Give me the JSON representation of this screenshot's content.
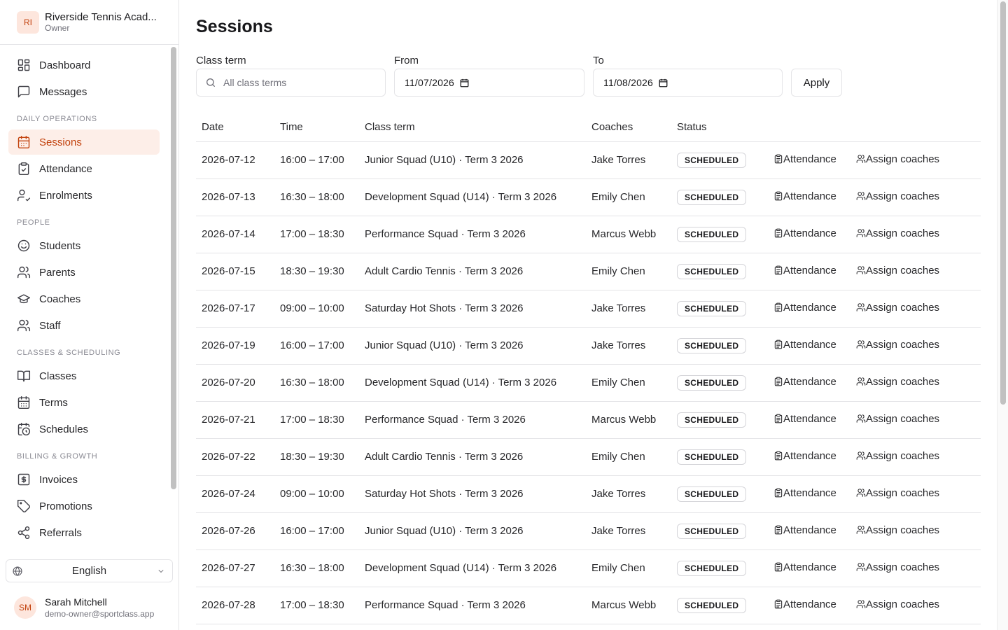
{
  "org": {
    "initials": "RI",
    "name": "Riverside Tennis Acad...",
    "role": "Owner"
  },
  "nav": {
    "top": [
      {
        "label": "Dashboard",
        "icon": "dashboard-icon"
      },
      {
        "label": "Messages",
        "icon": "message-icon"
      }
    ],
    "sections": [
      {
        "title": "DAILY OPERATIONS",
        "items": [
          {
            "label": "Sessions",
            "icon": "calendar-icon",
            "active": true
          },
          {
            "label": "Attendance",
            "icon": "clipboard-check-icon"
          },
          {
            "label": "Enrolments",
            "icon": "user-check-icon"
          }
        ]
      },
      {
        "title": "PEOPLE",
        "items": [
          {
            "label": "Students",
            "icon": "smile-icon"
          },
          {
            "label": "Parents",
            "icon": "users-icon"
          },
          {
            "label": "Coaches",
            "icon": "graduation-cap-icon"
          },
          {
            "label": "Staff",
            "icon": "users-icon"
          }
        ]
      },
      {
        "title": "CLASSES & SCHEDULING",
        "items": [
          {
            "label": "Classes",
            "icon": "book-icon"
          },
          {
            "label": "Terms",
            "icon": "calendar-days-icon"
          },
          {
            "label": "Schedules",
            "icon": "calendar-clock-icon"
          }
        ]
      },
      {
        "title": "BILLING & GROWTH",
        "items": [
          {
            "label": "Invoices",
            "icon": "receipt-icon"
          },
          {
            "label": "Promotions",
            "icon": "tag-icon"
          },
          {
            "label": "Referrals",
            "icon": "share-icon"
          }
        ]
      }
    ]
  },
  "language": {
    "selected": "English"
  },
  "user": {
    "initials": "SM",
    "name": "Sarah Mitchell",
    "email": "demo-owner@sportclass.app"
  },
  "page": {
    "title": "Sessions"
  },
  "filters": {
    "class_term_label": "Class term",
    "class_term_placeholder": "All class terms",
    "from_label": "From",
    "from_value": "11/07/2026",
    "to_label": "To",
    "to_value": "11/08/2026",
    "apply_label": "Apply"
  },
  "table": {
    "headers": [
      "Date",
      "Time",
      "Class term",
      "Coaches",
      "Status"
    ],
    "attendance_label": "Attendance",
    "assign_label": "Assign coaches",
    "rows": [
      {
        "date": "2026-07-12",
        "time": "16:00 – 17:00",
        "class_term": "Junior Squad (U10) · Term 3 2026",
        "coach": "Jake Torres",
        "status": "SCHEDULED"
      },
      {
        "date": "2026-07-13",
        "time": "16:30 – 18:00",
        "class_term": "Development Squad (U14) · Term 3 2026",
        "coach": "Emily Chen",
        "status": "SCHEDULED"
      },
      {
        "date": "2026-07-14",
        "time": "17:00 – 18:30",
        "class_term": "Performance Squad · Term 3 2026",
        "coach": "Marcus Webb",
        "status": "SCHEDULED"
      },
      {
        "date": "2026-07-15",
        "time": "18:30 – 19:30",
        "class_term": "Adult Cardio Tennis · Term 3 2026",
        "coach": "Emily Chen",
        "status": "SCHEDULED"
      },
      {
        "date": "2026-07-17",
        "time": "09:00 – 10:00",
        "class_term": "Saturday Hot Shots · Term 3 2026",
        "coach": "Jake Torres",
        "status": "SCHEDULED"
      },
      {
        "date": "2026-07-19",
        "time": "16:00 – 17:00",
        "class_term": "Junior Squad (U10) · Term 3 2026",
        "coach": "Jake Torres",
        "status": "SCHEDULED"
      },
      {
        "date": "2026-07-20",
        "time": "16:30 – 18:00",
        "class_term": "Development Squad (U14) · Term 3 2026",
        "coach": "Emily Chen",
        "status": "SCHEDULED"
      },
      {
        "date": "2026-07-21",
        "time": "17:00 – 18:30",
        "class_term": "Performance Squad · Term 3 2026",
        "coach": "Marcus Webb",
        "status": "SCHEDULED"
      },
      {
        "date": "2026-07-22",
        "time": "18:30 – 19:30",
        "class_term": "Adult Cardio Tennis · Term 3 2026",
        "coach": "Emily Chen",
        "status": "SCHEDULED"
      },
      {
        "date": "2026-07-24",
        "time": "09:00 – 10:00",
        "class_term": "Saturday Hot Shots · Term 3 2026",
        "coach": "Jake Torres",
        "status": "SCHEDULED"
      },
      {
        "date": "2026-07-26",
        "time": "16:00 – 17:00",
        "class_term": "Junior Squad (U10) · Term 3 2026",
        "coach": "Jake Torres",
        "status": "SCHEDULED"
      },
      {
        "date": "2026-07-27",
        "time": "16:30 – 18:00",
        "class_term": "Development Squad (U14) · Term 3 2026",
        "coach": "Emily Chen",
        "status": "SCHEDULED"
      },
      {
        "date": "2026-07-28",
        "time": "17:00 – 18:30",
        "class_term": "Performance Squad · Term 3 2026",
        "coach": "Marcus Webb",
        "status": "SCHEDULED"
      }
    ]
  },
  "colors": {
    "accent": "#c2410c",
    "accent_bg": "#fdeee8",
    "border": "#e4e4e7",
    "muted": "#71717a"
  }
}
